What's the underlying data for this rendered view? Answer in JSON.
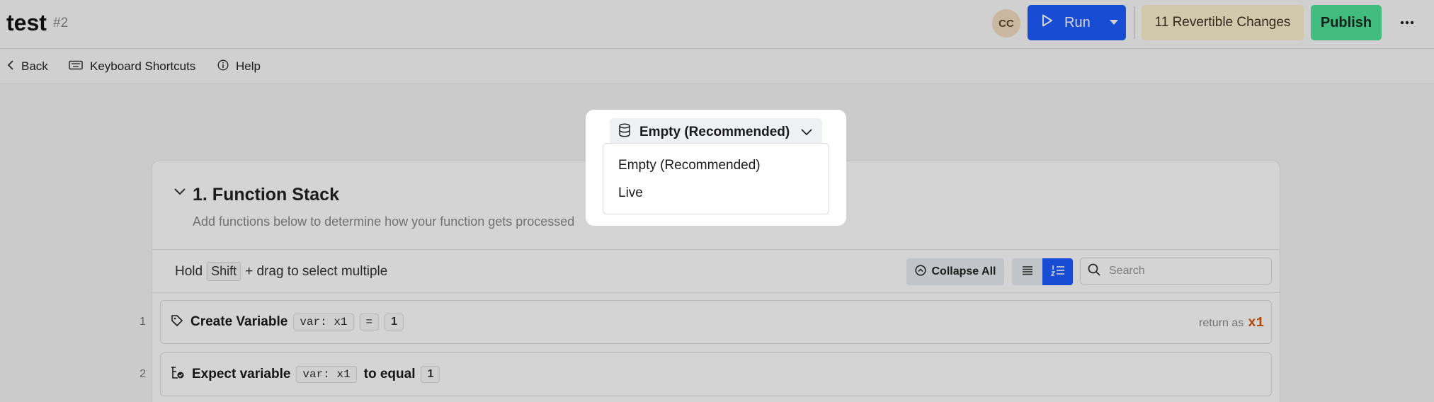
{
  "header": {
    "title": "test",
    "number": "#2",
    "avatar_initials": "CC",
    "run_label": "Run",
    "changes_label": "11 Revertible Changes",
    "publish_label": "Publish",
    "more_icon": "more-horizontal-icon"
  },
  "toolbar": {
    "back_label": "Back",
    "shortcuts_label": "Keyboard Shortcuts",
    "help_label": "Help"
  },
  "stack": {
    "title": "1. Function Stack",
    "subtitle": "Add functions below to determine how your function gets processed",
    "hold_prefix": "Hold",
    "hold_key": "Shift",
    "hold_suffix": "+ drag to select multiple",
    "collapse_label": "Collapse All",
    "search_placeholder": "Search",
    "rows": [
      {
        "num": "1",
        "label": "Create Variable",
        "var_prefix": "var:",
        "var_name": "x1",
        "operator": "=",
        "value": "1",
        "return_prefix": "return as",
        "return_var": "x1"
      },
      {
        "num": "2",
        "label": "Expect variable",
        "var_prefix": "var:",
        "var_name": "x1",
        "connector": "to equal",
        "value": "1"
      }
    ]
  },
  "datasource": {
    "selected": "Empty (Recommended)",
    "options": [
      "Empty (Recommended)",
      "Live"
    ]
  },
  "colors": {
    "accent": "#1e5cff",
    "publish": "#4fe199",
    "changes": "#fdf2cf",
    "return_var": "#d4580a"
  }
}
